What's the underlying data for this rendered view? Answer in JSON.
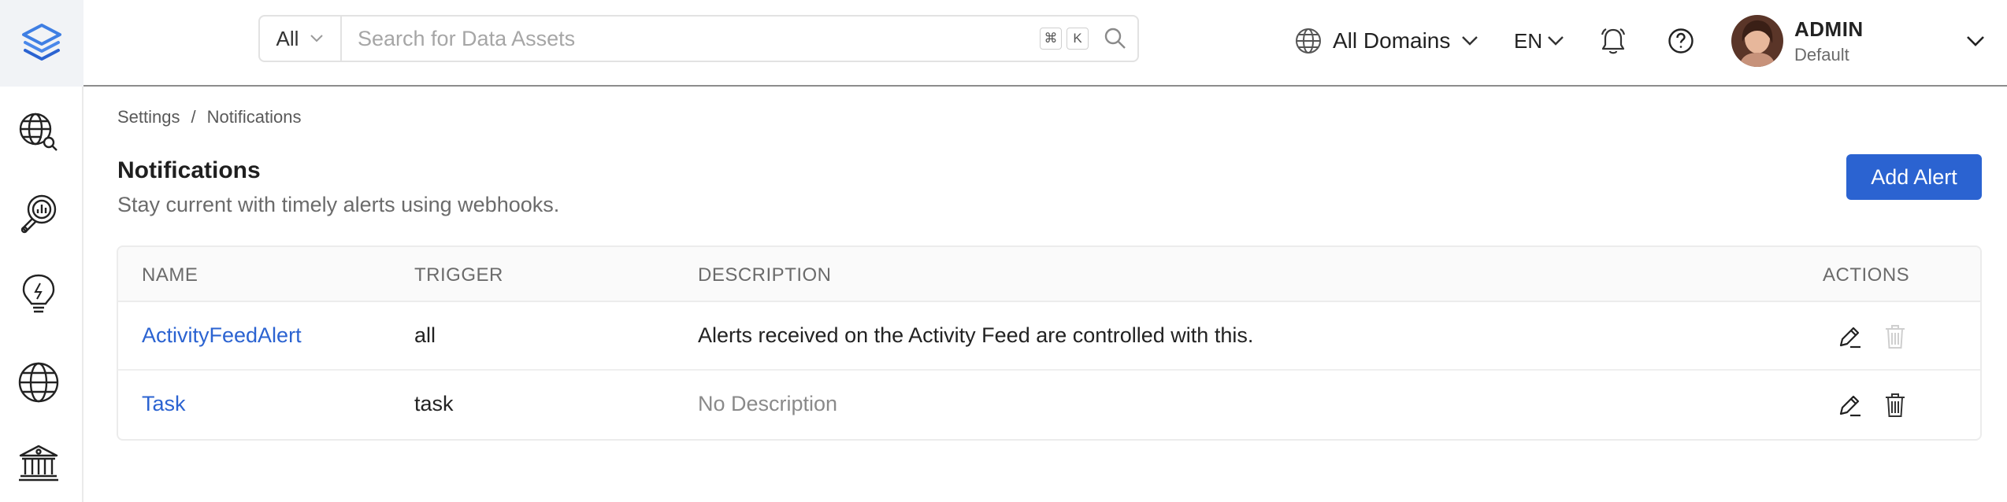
{
  "colors": {
    "accent": "#2b63d1",
    "sidebar_logo_bg": "#f1f3f6",
    "border": "#ececec"
  },
  "sidebar": {
    "logo_icon": "layers-logo-icon",
    "items": [
      {
        "icon": "explore-globe-search-icon"
      },
      {
        "icon": "data-quality-magnifier-icon"
      },
      {
        "icon": "insights-lightbulb-icon"
      },
      {
        "icon": "domains-globe-icon"
      },
      {
        "icon": "governance-building-icon"
      }
    ]
  },
  "topbar": {
    "search": {
      "category": "All",
      "placeholder": "Search for Data Assets",
      "shortcut_cmd": "⌘",
      "shortcut_key": "K"
    },
    "domain": {
      "label": "All Domains"
    },
    "language": {
      "label": "EN"
    },
    "user": {
      "name": "ADMIN",
      "role": "Default"
    }
  },
  "breadcrumb": {
    "items": [
      "Settings",
      "Notifications"
    ],
    "separator": "/"
  },
  "page": {
    "title": "Notifications",
    "subtitle": "Stay current with timely alerts using webhooks.",
    "add_button": "Add Alert"
  },
  "table": {
    "headers": {
      "name": "NAME",
      "trigger": "TRIGGER",
      "description": "DESCRIPTION",
      "actions": "ACTIONS"
    },
    "rows": [
      {
        "name": "ActivityFeedAlert",
        "trigger": "all",
        "description": "Alerts received on the Activity Feed are controlled with this.",
        "delete_disabled": true
      },
      {
        "name": "Task",
        "trigger": "task",
        "description": "No Description",
        "delete_disabled": false
      }
    ]
  }
}
